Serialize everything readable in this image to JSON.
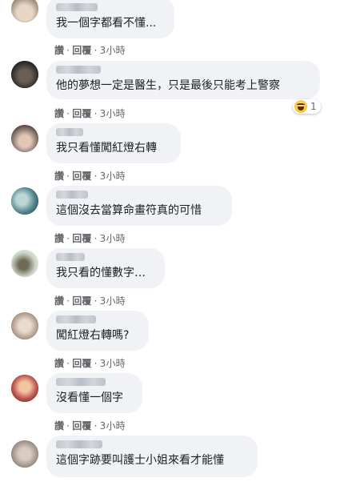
{
  "actions": {
    "like": "讚",
    "reply": "回覆",
    "separator": "·"
  },
  "comments": [
    {
      "text": "我一個字都看不懂...",
      "time": "3小時"
    },
    {
      "text": "他的夢想一定是醫生，只是最後只能考上警察",
      "time": "3小時",
      "reaction": {
        "icon": "haha-icon",
        "count": "1"
      }
    },
    {
      "text": "我只看懂闖紅燈右轉",
      "time": "3小時"
    },
    {
      "text": "這個沒去當算命畫符真的可惜",
      "time": "3小時"
    },
    {
      "text": "我只看的懂數字…",
      "time": "3小時"
    },
    {
      "text": "闖紅燈右轉嗎?",
      "time": "3小時"
    },
    {
      "text": "沒看懂一個字",
      "time": "3小時"
    },
    {
      "text": "這個字跡要叫護士小姐來看才能懂",
      "time": "3小時"
    }
  ],
  "colors": {
    "bubble_bg": "#f0f2f5",
    "text": "#1c1e21",
    "meta": "#65676b"
  }
}
